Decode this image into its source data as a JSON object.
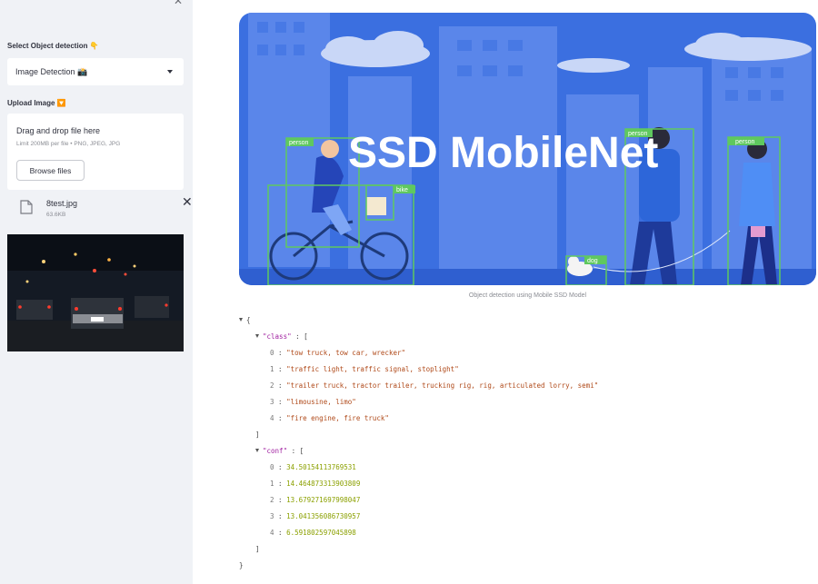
{
  "sidebar": {
    "select_label": "Select Object detection",
    "select_emoji": "👇",
    "select_value": "Image Detection 📸",
    "upload_label": "Upload Image",
    "upload_emoji": "🔽",
    "dropzone": {
      "title": "Drag and drop file here",
      "hint": "Limit 200MB per file • PNG, JPEG, JPG",
      "browse_label": "Browse files"
    },
    "file": {
      "name": "8test.jpg",
      "size": "63.6KB"
    }
  },
  "banner": {
    "title": "SSD MobileNet",
    "tags": [
      "person",
      "bike",
      "person",
      "dog",
      "person"
    ]
  },
  "caption": "Object detection using Mobile SSD Model",
  "json_output": {
    "class_key": "\"class\"",
    "conf_key": "\"conf\"",
    "class": [
      "\"tow truck, tow car, wrecker\"",
      "\"traffic light, traffic signal, stoplight\"",
      "\"trailer truck, tractor trailer, trucking rig, rig, articulated lorry, semi\"",
      "\"limousine, limo\"",
      "\"fire engine, fire truck\""
    ],
    "conf": [
      "34.50154113769531",
      "14.464873313903809",
      "13.679271697998047",
      "13.041356086730957",
      "6.591802597045898"
    ]
  },
  "colors": {
    "sidebar_bg": "#f0f2f6",
    "banner_bg": "#3b6fe0",
    "box_green": "#5fc85f",
    "json_key": "#a020a0",
    "json_string": "#b04a1a",
    "json_number": "#8ba000"
  }
}
